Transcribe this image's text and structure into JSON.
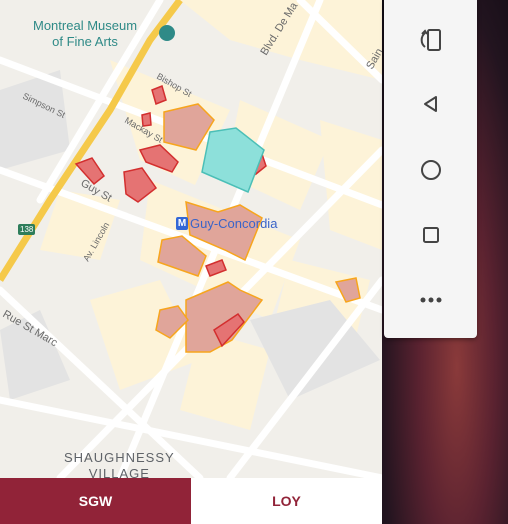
{
  "map": {
    "museum_label_line1": "Montreal Museum",
    "museum_label_line2": "of Fine Arts",
    "metro_symbol": "M",
    "metro_station": "Guy-Concordia",
    "neighbourhood_line1": "SHAUGHNESSY",
    "neighbourhood_line2": "VILLAGE",
    "route_shield": "138",
    "streets": {
      "bishop": "Bishop St",
      "mackay": "Mackay St",
      "guy": "Guy St",
      "simpson": "Simpson St",
      "de_maisonneuve": "Blvd. De Ma",
      "lincoln": "Av. Lincoln",
      "st_marc": "Rue St Marc",
      "sain": "Sain"
    }
  },
  "campus_tabs": [
    {
      "label": "SGW",
      "selected": true
    },
    {
      "label": "LOY",
      "selected": false
    }
  ],
  "colors": {
    "concordia_maroon": "#912338",
    "building_fill": "#e0a59a",
    "building_outline": "#f7a51d",
    "highlight_building": "#8de0da"
  }
}
